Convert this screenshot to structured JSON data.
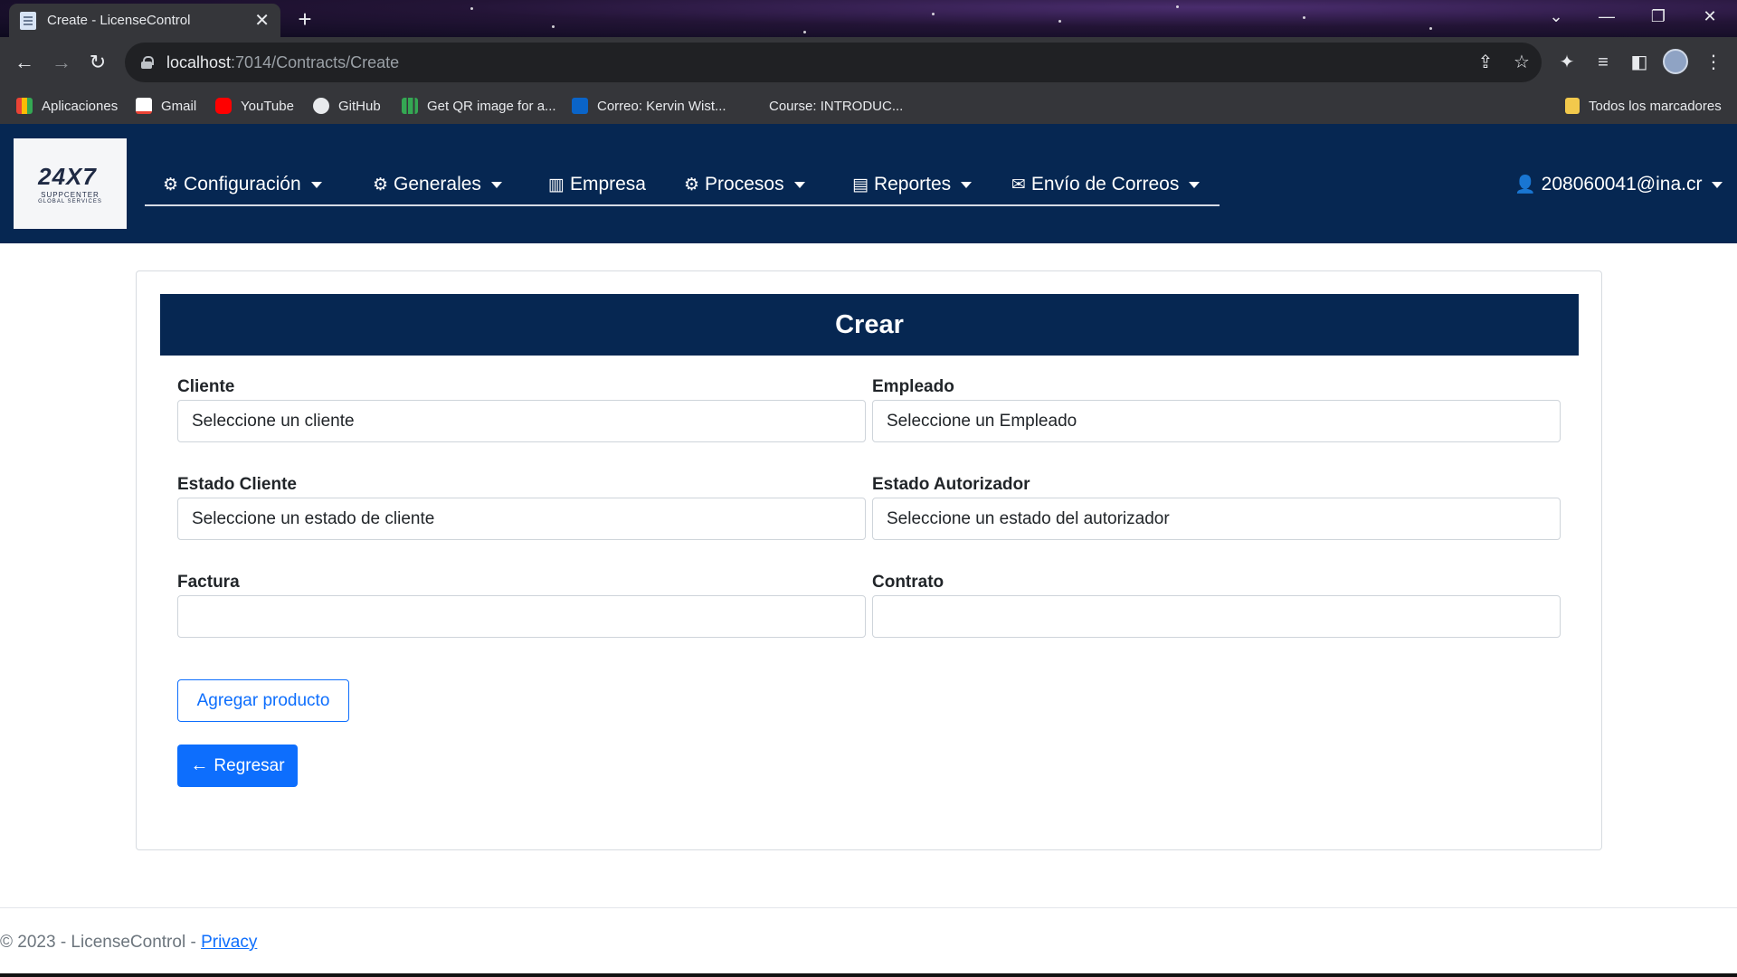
{
  "browser": {
    "tab_title": "Create - LicenseControl",
    "url_host": "localhost",
    "url_path": ":7014/Contracts/Create",
    "bookmarks": [
      {
        "label": "Aplicaciones",
        "icon": "apps-grid-icon"
      },
      {
        "label": "Gmail",
        "icon": "gmail-icon"
      },
      {
        "label": "YouTube",
        "icon": "youtube-icon"
      },
      {
        "label": "GitHub",
        "icon": "github-icon"
      },
      {
        "label": "Get QR image for a...",
        "icon": "chart-icon"
      },
      {
        "label": "Correo: Kervin Wist...",
        "icon": "outlook-icon"
      },
      {
        "label": "Course: INTRODUC...",
        "icon": "course-icon"
      }
    ],
    "all_bookmarks_label": "Todos los marcadores"
  },
  "navbar": {
    "logo_text": "24X7",
    "logo_sub": "SUPPCENTER",
    "logo_sub2": "GLOBAL SERVICES",
    "menu": [
      {
        "label": "Configuración",
        "icon": "gears-icon",
        "dropdown": true
      },
      {
        "label": "Generales",
        "icon": "gears-icon",
        "dropdown": true
      },
      {
        "label": "Empresa",
        "icon": "building-icon",
        "dropdown": false
      },
      {
        "label": "Procesos",
        "icon": "gears-icon",
        "dropdown": true
      },
      {
        "label": "Reportes",
        "icon": "pdf-file-icon",
        "dropdown": true
      },
      {
        "label": "Envío de Correos",
        "icon": "envelope-icon",
        "dropdown": true
      }
    ],
    "user": {
      "label": "208060041@ina.cr",
      "icon": "user-icon"
    }
  },
  "form": {
    "header": "Crear",
    "fields": {
      "cliente": {
        "label": "Cliente",
        "value": "Seleccione un cliente"
      },
      "empleado": {
        "label": "Empleado",
        "value": "Seleccione un Empleado"
      },
      "estado_cliente": {
        "label": "Estado Cliente",
        "value": "Seleccione un estado de cliente"
      },
      "estado_autorizador": {
        "label": "Estado Autorizador",
        "value": "Seleccione un estado del autorizador"
      },
      "factura": {
        "label": "Factura",
        "value": ""
      },
      "contrato": {
        "label": "Contrato",
        "value": ""
      }
    },
    "add_product_label": "Agregar producto",
    "back_label": "Regresar"
  },
  "footer": {
    "text": "© 2023 - LicenseControl - ",
    "privacy_label": "Privacy"
  },
  "colors": {
    "navy": "#062752",
    "primary": "#0d6efd"
  }
}
